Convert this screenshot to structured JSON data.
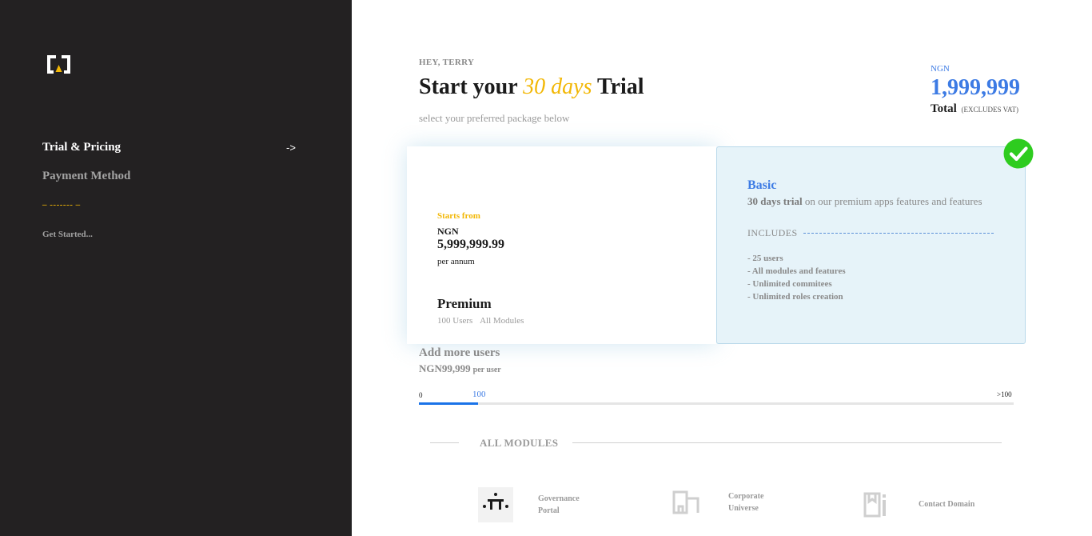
{
  "sidebar": {
    "logo_icon": "bracket-logo-icon",
    "nav": {
      "trial_pricing": "Trial & Pricing",
      "arrow": "->",
      "payment_method": "Payment Method",
      "divider": "– ------- –",
      "get_started": "Get Started..."
    }
  },
  "header": {
    "greeting": "HEY, TERRY",
    "title_prefix": "Start your",
    "title_highlight": "30 days",
    "title_suffix": "Trial",
    "subtitle": "select your preferred package below"
  },
  "total": {
    "currency": "NGN",
    "amount": "1,999,999",
    "label": "Total",
    "note": "(EXCLUDES VAT)"
  },
  "plans": {
    "premium": {
      "starts_from": "Starts from",
      "currency": "NGN",
      "price": "5,999,999.99",
      "period": "per annum",
      "name": "Premium",
      "feature_users": "100 Users",
      "feature_modules": "All Modules"
    },
    "basic": {
      "name": "Basic",
      "desc_bold": "30 days trial",
      "desc_rest": " on our premium apps features and features",
      "includes": "INCLUDES",
      "items": [
        "- 25 users",
        "- All modules and features",
        "- Unlimited commitees",
        "- Unlimited roles creation"
      ],
      "selected": true,
      "check_icon": "check-circle-icon",
      "accent_color": "#3d7be4",
      "check_color": "#2ecc1f"
    }
  },
  "add_users": {
    "title": "Add more users",
    "price": "NGN99,999",
    "per": "per user",
    "slider": {
      "min_label": "0",
      "value_label": "100",
      "max_label": ">100",
      "fill_fraction": 0.1
    }
  },
  "modules": {
    "title": "ALL MODULES",
    "items": [
      {
        "icon": "governance-portal-icon",
        "label_line1": "Governance",
        "label_line2": "Portal"
      },
      {
        "icon": "corporate-universe-icon",
        "label_line1": "Corporate",
        "label_line2": "Universe"
      },
      {
        "icon": "contact-domain-icon",
        "label_line1": "Contact Domain",
        "label_line2": ""
      }
    ]
  },
  "colors": {
    "sidebar_bg": "#232122",
    "brand_yellow": "#f2b705",
    "accent_blue": "#3d7be4",
    "slider_blue": "#1a73e8",
    "basic_card_bg": "#e6f3f9"
  }
}
